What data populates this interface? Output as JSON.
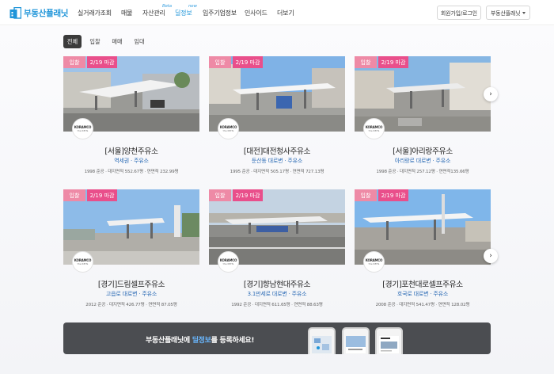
{
  "header": {
    "logo_text": "부동산플래닛",
    "nav": [
      {
        "label": "실거래가조회",
        "sup": ""
      },
      {
        "label": "매물",
        "sup": ""
      },
      {
        "label": "자산관리",
        "sup": "Beta"
      },
      {
        "label": "딜정보",
        "sup": "new"
      },
      {
        "label": "입주기업정보",
        "sup": ""
      },
      {
        "label": "인사이드",
        "sup": ""
      },
      {
        "label": "더보기",
        "sup": ""
      }
    ],
    "login_label": "회원가입/로그인",
    "site_select": "부동산플래닛"
  },
  "tabs": [
    "전체",
    "입찰",
    "매매",
    "임대"
  ],
  "active_tab": "전체",
  "next_arrow": "›",
  "cards": [
    {
      "badge": "입찰",
      "deadline": "2/19 마감",
      "logo_main": "KORAMCO",
      "logo_sub": "the REITs",
      "title": "[서울]양천주유소",
      "sub": "역세권 · 주유소",
      "meta": "1998 준공  ·  대지면적 552.67평  ·  연면적 232.99평"
    },
    {
      "badge": "입찰",
      "deadline": "2/19 마감",
      "logo_main": "KORAMCO",
      "logo_sub": "the REITs",
      "title": "[대전]대전청사주유소",
      "sub": "둔산동 대로변 · 주유소",
      "meta": "1995 준공  ·  대지면적 505.17평  ·  연면적 727.13평"
    },
    {
      "badge": "입찰",
      "deadline": "2/19 마감",
      "logo_main": "KORAMCO",
      "logo_sub": "the REITs",
      "title": "[서울]아리랑주유소",
      "sub": "아리랑로 대로변 · 주유소",
      "meta": "1998 준공  ·  대지면적 257.12평  ·  연면적135.66평"
    },
    {
      "badge": "입찰",
      "deadline": "2/19 마감",
      "logo_main": "KORAMCO",
      "logo_sub": "the REITs",
      "title": "[경기]드림셀프주유소",
      "sub": "고읍로 대로변 · 주유소",
      "meta": "2012 준공  ·  대지면적 426.77평  ·  연면적 87.05평"
    },
    {
      "badge": "입찰",
      "deadline": "2/19 마감",
      "logo_main": "KORAMCO",
      "logo_sub": "the REITs",
      "title": "[경기]향남현대주유소",
      "sub": "3.1만세로 대로변 · 주유소",
      "meta": "1992 준공  ·  대지면적 611.65평  ·  연면적 88.63평"
    },
    {
      "badge": "입찰",
      "deadline": "2/19 마감",
      "logo_main": "KORAMCO",
      "logo_sub": "the REITs",
      "title": "[경기]포천대로셀프주유소",
      "sub": "호국로 대로변 · 주유소",
      "meta": "2008 준공  ·  대지면적 541.47평  ·  연면적 128.02평"
    }
  ],
  "banner": {
    "text_before": "부동산플래닛에 ",
    "highlight": "딜정보",
    "text_after": "를 등록하세요!"
  },
  "colors": {
    "brand": "#1f95d9",
    "badge_pink": "#ee8aa6",
    "deadline_pink": "#e94f8b",
    "link_blue": "#2d6cb5",
    "banner_bg": "#4b4d51"
  }
}
